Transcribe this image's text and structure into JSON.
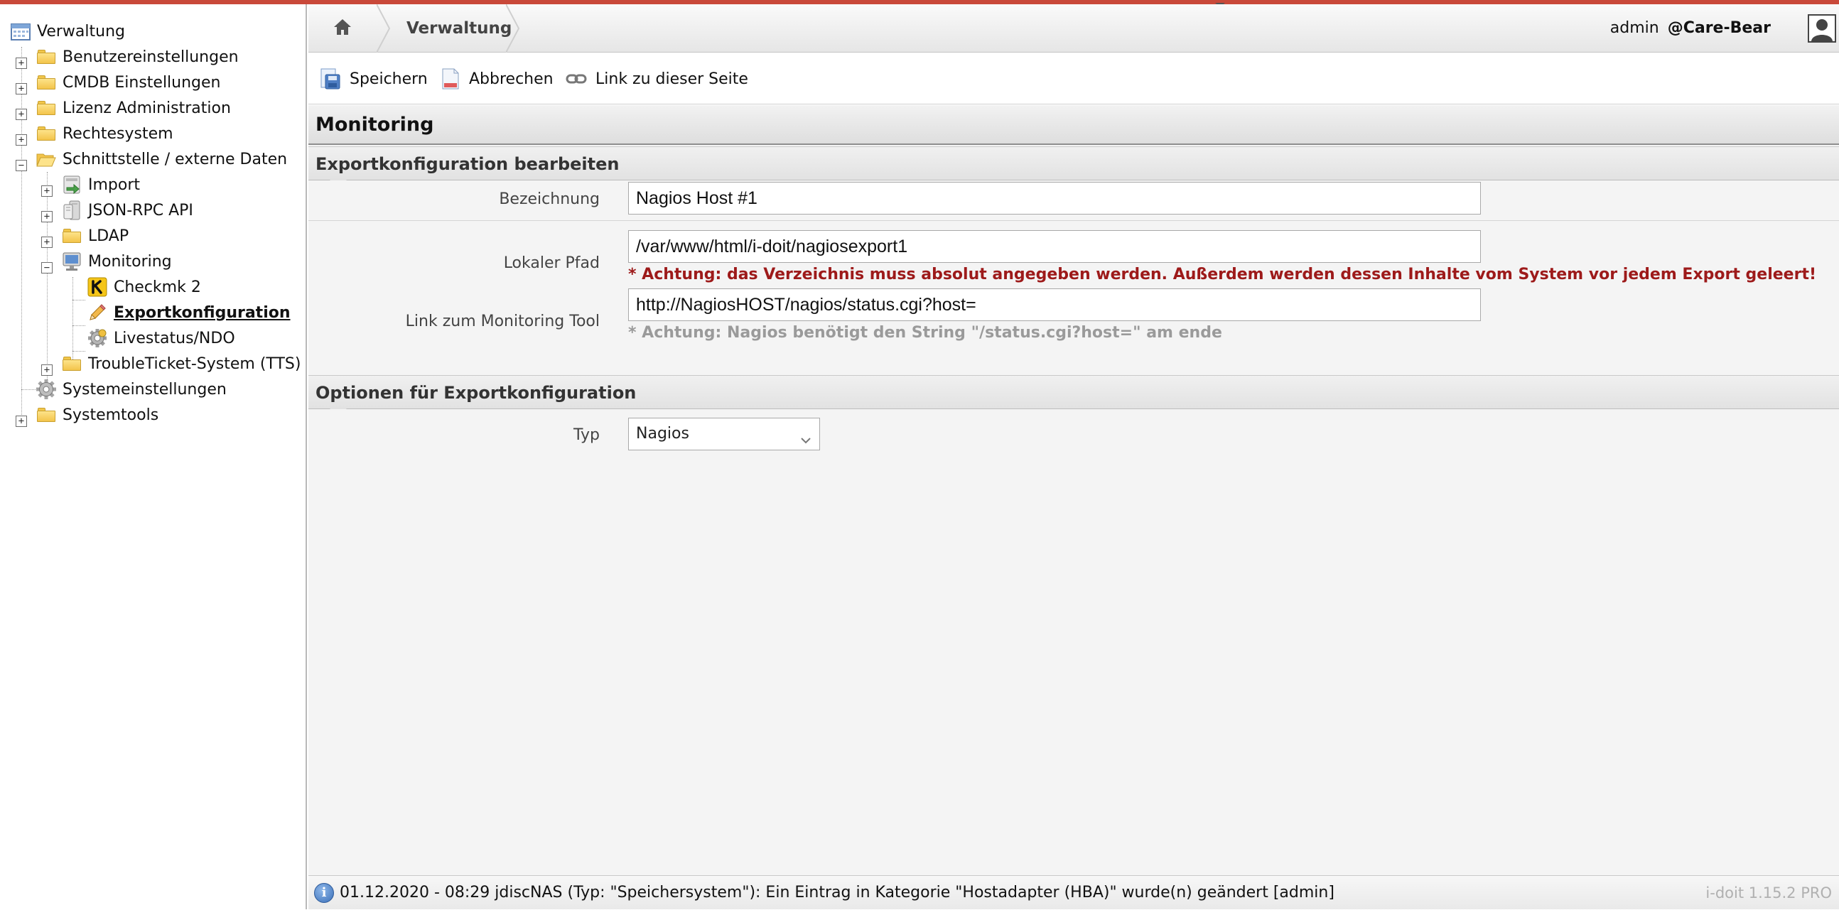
{
  "header": {
    "breadcrumb": "Verwaltung",
    "user": "admin",
    "tenant": "@Care-Bear"
  },
  "toolbar": {
    "save_label": "Speichern",
    "cancel_label": "Abbrechen",
    "link_label": "Link zu dieser Seite"
  },
  "sidebar": {
    "root": "Verwaltung",
    "items": [
      {
        "label": "Benutzereinstellungen",
        "icon": "folder-icon"
      },
      {
        "label": "CMDB Einstellungen",
        "icon": "folder-icon"
      },
      {
        "label": "Lizenz Administration",
        "icon": "folder-icon"
      },
      {
        "label": "Rechtesystem",
        "icon": "folder-icon"
      },
      {
        "label": "Schnittstelle / externe Daten",
        "icon": "folder-open-icon"
      },
      {
        "label": "Import",
        "icon": "import-icon"
      },
      {
        "label": "JSON-RPC API",
        "icon": "server-icon"
      },
      {
        "label": "LDAP",
        "icon": "folder-icon"
      },
      {
        "label": "Monitoring",
        "icon": "monitor-icon"
      },
      {
        "label": "Checkmk 2",
        "icon": "checkmk-icon"
      },
      {
        "label": "Exportkonfiguration",
        "icon": "pencil-icon"
      },
      {
        "label": "Livestatus/NDO",
        "icon": "gear-icon"
      },
      {
        "label": "TroubleTicket-System (TTS)",
        "icon": "folder-icon"
      },
      {
        "label": "Systemeinstellungen",
        "icon": "gear-icon"
      },
      {
        "label": "Systemtools",
        "icon": "folder-icon"
      }
    ]
  },
  "main": {
    "title": "Monitoring",
    "section1": "Exportkonfiguration bearbeiten",
    "fields": {
      "bezeichnung_label": "Bezeichnung",
      "bezeichnung_value": "Nagios Host #1",
      "pfad_label": "Lokaler Pfad",
      "pfad_value": "/var/www/html/i-doit/nagiosexport1",
      "pfad_warning": "* Achtung: das Verzeichnis muss absolut angegeben werden. Außerdem werden dessen Inhalte vom System vor jedem Export geleert!",
      "link_label": "Link zum Monitoring Tool",
      "link_value": "http://NagiosHOST/nagios/status.cgi?host=",
      "link_warning": "* Achtung: Nagios benötigt den String \"/status.cgi?host=\" am ende"
    },
    "section2": "Optionen für Exportkonfiguration",
    "typ_label": "Typ",
    "typ_value": "Nagios"
  },
  "statusbar": {
    "message": "01.12.2020 - 08:29 jdiscNAS (Typ: \"Speichersystem\"): Ein Eintrag in Kategorie \"Hostadapter (HBA)\" wurde(n) geändert [admin]",
    "version": "i-doit 1.15.2 PRO"
  },
  "colors": {
    "accent_top": "#c9493a",
    "warning_red": "#9d1a1a",
    "hint_grey": "#9a9a9a"
  }
}
